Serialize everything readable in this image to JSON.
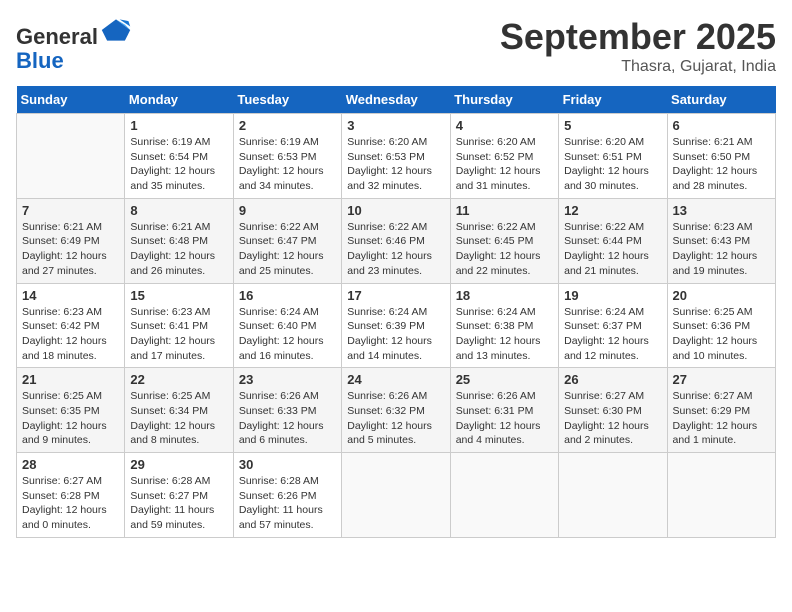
{
  "header": {
    "logo_general": "General",
    "logo_blue": "Blue",
    "month_title": "September 2025",
    "month_subtitle": "Thasra, Gujarat, India"
  },
  "calendar": {
    "days_of_week": [
      "Sunday",
      "Monday",
      "Tuesday",
      "Wednesday",
      "Thursday",
      "Friday",
      "Saturday"
    ],
    "weeks": [
      [
        {
          "day": "",
          "info": ""
        },
        {
          "day": "1",
          "info": "Sunrise: 6:19 AM\nSunset: 6:54 PM\nDaylight: 12 hours\nand 35 minutes."
        },
        {
          "day": "2",
          "info": "Sunrise: 6:19 AM\nSunset: 6:53 PM\nDaylight: 12 hours\nand 34 minutes."
        },
        {
          "day": "3",
          "info": "Sunrise: 6:20 AM\nSunset: 6:53 PM\nDaylight: 12 hours\nand 32 minutes."
        },
        {
          "day": "4",
          "info": "Sunrise: 6:20 AM\nSunset: 6:52 PM\nDaylight: 12 hours\nand 31 minutes."
        },
        {
          "day": "5",
          "info": "Sunrise: 6:20 AM\nSunset: 6:51 PM\nDaylight: 12 hours\nand 30 minutes."
        },
        {
          "day": "6",
          "info": "Sunrise: 6:21 AM\nSunset: 6:50 PM\nDaylight: 12 hours\nand 28 minutes."
        }
      ],
      [
        {
          "day": "7",
          "info": "Sunrise: 6:21 AM\nSunset: 6:49 PM\nDaylight: 12 hours\nand 27 minutes."
        },
        {
          "day": "8",
          "info": "Sunrise: 6:21 AM\nSunset: 6:48 PM\nDaylight: 12 hours\nand 26 minutes."
        },
        {
          "day": "9",
          "info": "Sunrise: 6:22 AM\nSunset: 6:47 PM\nDaylight: 12 hours\nand 25 minutes."
        },
        {
          "day": "10",
          "info": "Sunrise: 6:22 AM\nSunset: 6:46 PM\nDaylight: 12 hours\nand 23 minutes."
        },
        {
          "day": "11",
          "info": "Sunrise: 6:22 AM\nSunset: 6:45 PM\nDaylight: 12 hours\nand 22 minutes."
        },
        {
          "day": "12",
          "info": "Sunrise: 6:22 AM\nSunset: 6:44 PM\nDaylight: 12 hours\nand 21 minutes."
        },
        {
          "day": "13",
          "info": "Sunrise: 6:23 AM\nSunset: 6:43 PM\nDaylight: 12 hours\nand 19 minutes."
        }
      ],
      [
        {
          "day": "14",
          "info": "Sunrise: 6:23 AM\nSunset: 6:42 PM\nDaylight: 12 hours\nand 18 minutes."
        },
        {
          "day": "15",
          "info": "Sunrise: 6:23 AM\nSunset: 6:41 PM\nDaylight: 12 hours\nand 17 minutes."
        },
        {
          "day": "16",
          "info": "Sunrise: 6:24 AM\nSunset: 6:40 PM\nDaylight: 12 hours\nand 16 minutes."
        },
        {
          "day": "17",
          "info": "Sunrise: 6:24 AM\nSunset: 6:39 PM\nDaylight: 12 hours\nand 14 minutes."
        },
        {
          "day": "18",
          "info": "Sunrise: 6:24 AM\nSunset: 6:38 PM\nDaylight: 12 hours\nand 13 minutes."
        },
        {
          "day": "19",
          "info": "Sunrise: 6:24 AM\nSunset: 6:37 PM\nDaylight: 12 hours\nand 12 minutes."
        },
        {
          "day": "20",
          "info": "Sunrise: 6:25 AM\nSunset: 6:36 PM\nDaylight: 12 hours\nand 10 minutes."
        }
      ],
      [
        {
          "day": "21",
          "info": "Sunrise: 6:25 AM\nSunset: 6:35 PM\nDaylight: 12 hours\nand 9 minutes."
        },
        {
          "day": "22",
          "info": "Sunrise: 6:25 AM\nSunset: 6:34 PM\nDaylight: 12 hours\nand 8 minutes."
        },
        {
          "day": "23",
          "info": "Sunrise: 6:26 AM\nSunset: 6:33 PM\nDaylight: 12 hours\nand 6 minutes."
        },
        {
          "day": "24",
          "info": "Sunrise: 6:26 AM\nSunset: 6:32 PM\nDaylight: 12 hours\nand 5 minutes."
        },
        {
          "day": "25",
          "info": "Sunrise: 6:26 AM\nSunset: 6:31 PM\nDaylight: 12 hours\nand 4 minutes."
        },
        {
          "day": "26",
          "info": "Sunrise: 6:27 AM\nSunset: 6:30 PM\nDaylight: 12 hours\nand 2 minutes."
        },
        {
          "day": "27",
          "info": "Sunrise: 6:27 AM\nSunset: 6:29 PM\nDaylight: 12 hours\nand 1 minute."
        }
      ],
      [
        {
          "day": "28",
          "info": "Sunrise: 6:27 AM\nSunset: 6:28 PM\nDaylight: 12 hours\nand 0 minutes."
        },
        {
          "day": "29",
          "info": "Sunrise: 6:28 AM\nSunset: 6:27 PM\nDaylight: 11 hours\nand 59 minutes."
        },
        {
          "day": "30",
          "info": "Sunrise: 6:28 AM\nSunset: 6:26 PM\nDaylight: 11 hours\nand 57 minutes."
        },
        {
          "day": "",
          "info": ""
        },
        {
          "day": "",
          "info": ""
        },
        {
          "day": "",
          "info": ""
        },
        {
          "day": "",
          "info": ""
        }
      ]
    ]
  }
}
